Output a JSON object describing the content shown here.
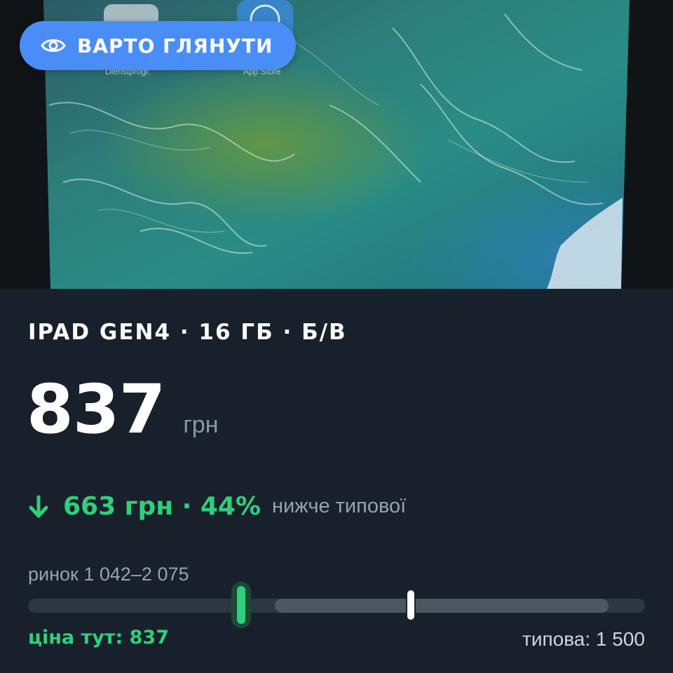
{
  "photo": {
    "description_icons": [
      "Dienstprogr.",
      "App Store"
    ]
  },
  "badge": {
    "label": "ВАРТО ГЛЯНУТИ",
    "icon": "eye-icon"
  },
  "listing": {
    "title": "IPAD GEN4 · 16 ГБ · Б/В",
    "price": "837",
    "currency": "грн",
    "difference": "663 грн · 44%",
    "difference_note": "нижче типової",
    "difference_icon": "arrow-down-icon"
  },
  "market": {
    "range_label": "ринок 1 042–2 075",
    "here_label": "ціна тут: 837",
    "typical_label": "типова: 1 500",
    "price_value": 837,
    "range_min": 1042,
    "range_max": 2075,
    "typical_value": 1500
  },
  "colors": {
    "badge": "#4a8df6",
    "background": "#18212b",
    "accent_green": "#2fcf7c"
  }
}
